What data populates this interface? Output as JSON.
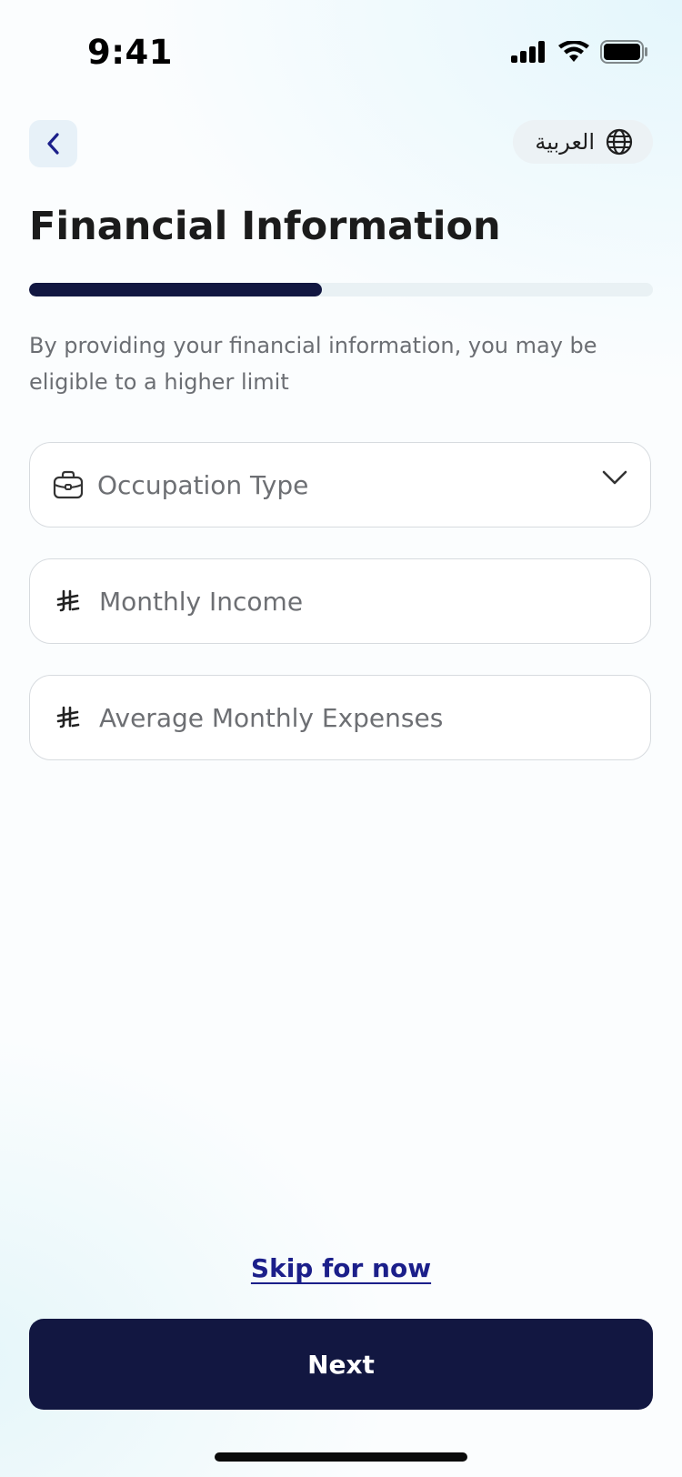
{
  "status_bar": {
    "time": "9:41",
    "icons": [
      "signal-icon",
      "wifi-icon",
      "battery-icon"
    ]
  },
  "header": {
    "back_icon": "chevron-left-icon",
    "language_label": "العربية",
    "language_icon": "globe-icon"
  },
  "page": {
    "title": "Financial Information",
    "progress": 0.47,
    "description": "By providing your financial information, you may be eligible to a higher limit"
  },
  "form": {
    "occupation": {
      "placeholder": "Occupation Type",
      "icon": "briefcase-icon",
      "dropdown_icon": "chevron-down-icon"
    },
    "monthly_income": {
      "placeholder": "Monthly Income",
      "icon": "riyal-currency-icon",
      "value": ""
    },
    "monthly_expenses": {
      "placeholder": "Average Monthly Expenses",
      "icon": "riyal-currency-icon",
      "value": ""
    }
  },
  "actions": {
    "skip_label": "Skip for now",
    "next_label": "Next"
  },
  "colors": {
    "primary": "#121741",
    "link": "#1b1f8a",
    "track": "#e9f1f4"
  }
}
